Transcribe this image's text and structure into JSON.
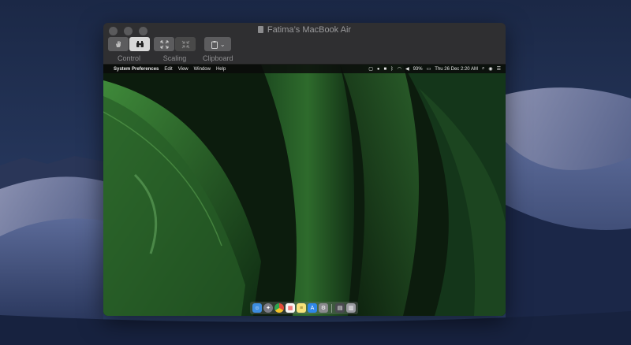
{
  "window": {
    "title": "Fatima’s MacBook Air"
  },
  "toolbar": {
    "control_label": "Control",
    "scaling_label": "Scaling",
    "clipboard_label": "Clipboard",
    "clipboard_chevron": "⌄"
  },
  "remote_menubar": {
    "apple_symbol": "",
    "app_name": "System Preferences",
    "menus": [
      "Edit",
      "View",
      "Window",
      "Help"
    ],
    "battery": "93%",
    "datetime": "Thu 26 Dec  2:20 AM"
  },
  "icons": {
    "control_hand": "hand-icon",
    "control_binoculars": "binoculars-icon",
    "scaling_fit": "fit-to-window-icon",
    "scaling_full": "full-size-icon",
    "clipboard": "clipboard-icon",
    "dock": [
      "finder-icon",
      "launchpad-icon",
      "chrome-icon",
      "calendar-icon",
      "notes-icon",
      "app-store-icon",
      "system-preferences-icon",
      "downloads-stack-icon",
      "trash-icon"
    ]
  },
  "colors": {
    "window_bg": "#2d2d2f",
    "toolbar_active": "#d8d8d8",
    "remote_wallpaper": "#1f4a22"
  }
}
